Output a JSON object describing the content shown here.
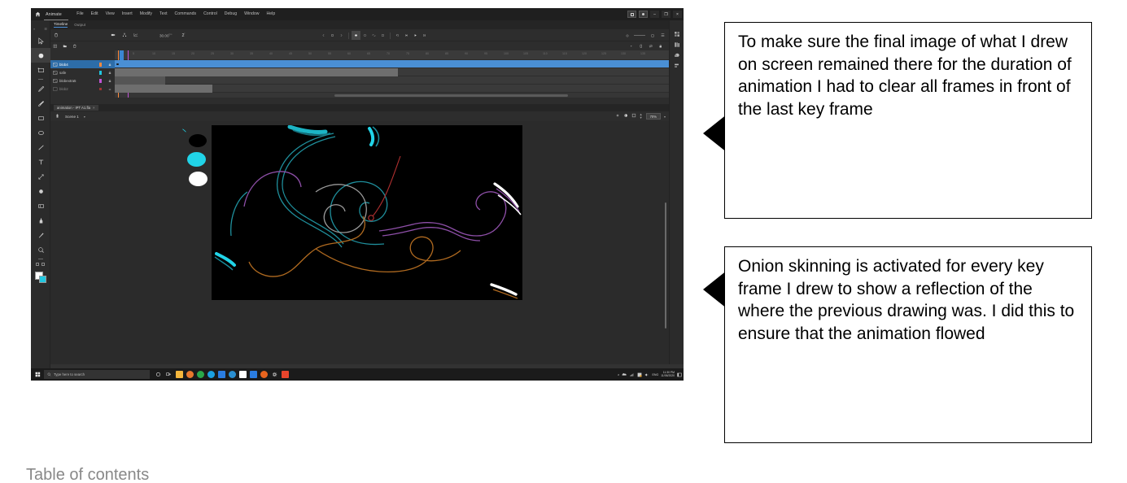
{
  "app": {
    "name": "Animate",
    "home_icon": "home-icon",
    "menu": [
      "File",
      "Edit",
      "View",
      "Insert",
      "Modify",
      "Text",
      "Commands",
      "Control",
      "Debug",
      "Window",
      "Help"
    ],
    "window_buttons": {
      "minimize": "–",
      "restore": "❐",
      "close": "×"
    }
  },
  "toolbar": {
    "tools": [
      {
        "name": "selection-tool",
        "glyph": "arrow"
      },
      {
        "name": "subselection-tool",
        "glyph": "blob"
      },
      {
        "name": "free-transform-tool",
        "glyph": "transform"
      },
      {
        "name": "pencil-tool",
        "glyph": "pencil"
      },
      {
        "name": "brush-tool",
        "glyph": "brush"
      },
      {
        "name": "rectangle-tool",
        "glyph": "rect"
      },
      {
        "name": "oval-tool",
        "glyph": "oval"
      },
      {
        "name": "line-tool",
        "glyph": "line"
      },
      {
        "name": "text-tool",
        "glyph": "text"
      },
      {
        "name": "bone-tool",
        "glyph": "bone"
      },
      {
        "name": "paint-bucket-tool",
        "glyph": "bucket"
      },
      {
        "name": "eraser-tool",
        "glyph": "eraser"
      },
      {
        "name": "ink-bottle-tool",
        "glyph": "ink"
      },
      {
        "name": "eyedropper-tool",
        "glyph": "dropper"
      },
      {
        "name": "zoom-tool",
        "glyph": "magnifier"
      }
    ],
    "selected_tool": "subselection-tool",
    "stroke_color": "#ffffff",
    "fill_color": "#21c7e0"
  },
  "timeline": {
    "tabs": [
      {
        "label": "Timeline",
        "active": true
      },
      {
        "label": "Output",
        "active": false
      }
    ],
    "frame_rate": "30.00",
    "frame_rate_unit": "fps",
    "current_frame": "2",
    "current_frame_unit": "f",
    "tool_icons": [
      "delete-icon",
      "camera-icon",
      "parent-view-icon",
      "graph-editor-icon"
    ],
    "layer_tool_icons": [
      "new-layer-icon",
      "new-folder-icon",
      "delete-layer-icon"
    ],
    "playback_icons": [
      "prev-keyframe-icon",
      "stop-icon",
      "next-keyframe-icon",
      "onion-skin-icon",
      "onion-outline-icon",
      "edit-multiple-icon",
      "modify-markers-icon",
      "loop-icon",
      "step-back-icon",
      "play-icon",
      "step-forward-icon"
    ],
    "onion_skin_active": true,
    "ruler_numbers": [
      "5",
      "10",
      "15",
      "20",
      "25",
      "30",
      "35",
      "40",
      "45",
      "50",
      "55",
      "60",
      "65",
      "70",
      "75",
      "80",
      "85",
      "90",
      "95",
      "100",
      "105",
      "110",
      "115",
      "120",
      "125",
      "130",
      "135"
    ],
    "layers": [
      {
        "name": "blob4",
        "color": "#ff8a3d",
        "selected": true,
        "locked": true
      },
      {
        "name": "safe",
        "color": "#21c7e0",
        "selected": false,
        "locked": true
      },
      {
        "name": "blobextra5",
        "color": "#c154d6",
        "selected": false,
        "locked": true
      },
      {
        "name": "blob2",
        "color": "#ff3d3d",
        "selected": false,
        "locked": true
      }
    ],
    "playhead_frame": "2"
  },
  "document": {
    "tab_label": "animation - IPT A1.fla",
    "tab_close": "×",
    "scene": "Scene 1",
    "scene_caret": "▾",
    "zoom": "70%",
    "zoom_caret": "▾",
    "stage_background": "#000000",
    "stage_icons": [
      "center-stage-icon",
      "clip-content-icon",
      "fit-stage-icon",
      "stage-size-icon"
    ]
  },
  "right_dock": {
    "panels": [
      "properties-panel-icon",
      "library-panel-icon",
      "color-panel-icon",
      "align-panel-icon"
    ]
  },
  "artwork": {
    "description": "Abstract spiral line drawing on black stage",
    "offstage_ovals": [
      {
        "name": "black-oval",
        "color": "#000000"
      },
      {
        "name": "cyan-oval",
        "color": "#21d4e8"
      },
      {
        "name": "white-oval",
        "color": "#ffffff"
      }
    ],
    "stroke_colors": [
      "#1f8f9c",
      "#8e4fa8",
      "#b06a20",
      "#9a9a9a",
      "#b03030",
      "#ffffff",
      "#21d4e8"
    ]
  },
  "taskbar": {
    "start_icon": "windows-start-icon",
    "search_icon": "search-icon",
    "search_placeholder": "Type here to search",
    "cortana_icon": "cortana-circle-icon",
    "taskview_icon": "task-view-icon",
    "apps": [
      {
        "name": "file-explorer-icon",
        "color": "#f5b73d"
      },
      {
        "name": "firefox-icon",
        "color": "#e8782d"
      },
      {
        "name": "chrome-icon",
        "color": "#2aa84a"
      },
      {
        "name": "edge-icon",
        "color": "#1ba1e2"
      },
      {
        "name": "mail-icon",
        "color": "#2a7de1"
      },
      {
        "name": "store-icon",
        "color": "#2a8fd1"
      },
      {
        "name": "word-icon",
        "color": "#ffffff"
      },
      {
        "name": "check-icon",
        "color": "#2a7de1"
      },
      {
        "name": "reader-icon",
        "color": "#e8641e"
      },
      {
        "name": "settings-icon",
        "color": "#cfcfcf"
      },
      {
        "name": "animate-icon",
        "color": "#e8452c"
      }
    ],
    "tray": {
      "chevron": "∧",
      "icons": [
        "cloud-icon",
        "network-icon",
        "security-icon",
        "volume-icon"
      ],
      "language": "ENG",
      "time": "11:30 PM",
      "date": "11/06/2020",
      "notification_icon": "action-center-icon"
    }
  },
  "callouts": [
    {
      "id": "callout-clear-frames",
      "text": "To make sure the final image of what I drew on screen remained there for the duration of animation I had to clear all frames in front of the last key frame"
    },
    {
      "id": "callout-onion-skinning",
      "text": "Onion skinning is activated for every key frame I drew to show a reflection of the where the previous drawing was. I did this to ensure that the animation flowed"
    }
  ],
  "page": {
    "cut_off_heading": "Table of contents"
  }
}
